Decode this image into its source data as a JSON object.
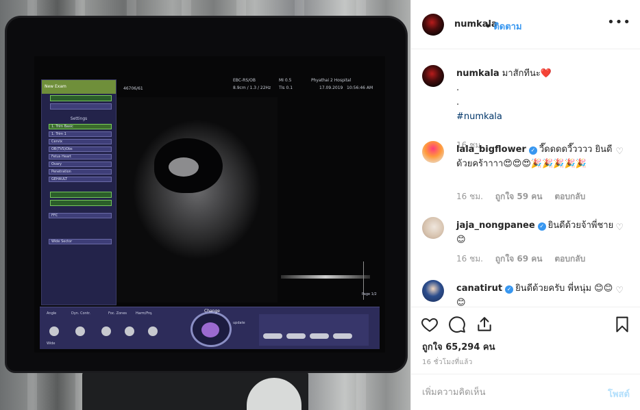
{
  "post": {
    "author": "numkala",
    "separator": "•",
    "follow_label": "ติดตาม",
    "more_label": "•••",
    "caption": {
      "text": "มาสักทีนะ",
      "heart": "❤️",
      "dot1": ".",
      "dot2": ".",
      "hashtag": "#numkala",
      "time": "16 ชม."
    }
  },
  "comments": [
    {
      "username": "lala_bigflower",
      "verified": true,
      "text": "วี๊ดดดดวี๊วววว ยินดีด้วยคร้าาาา😍😍😍🎉🎉🎉🎉🎉",
      "time": "16 ชม.",
      "likes": "ถูกใจ 59 คน",
      "reply": "ตอบกลับ"
    },
    {
      "username": "jaja_nongpanee",
      "verified": true,
      "text": "ยินดีด้วยจ้าพี่ชาย 😊",
      "time": "16 ชม.",
      "likes": "ถูกใจ 69 คน",
      "reply": "ตอบกลับ"
    },
    {
      "username": "canatirut",
      "verified": true,
      "text": "ยินดีด้วยครับ พี่หนุ่ม 😊😊😊"
    }
  ],
  "actions": {
    "like_count": "ถูกใจ 65,294 คน",
    "timestamp": "16 ชั่วโมงที่แล้ว"
  },
  "add_comment": {
    "placeholder": "เพิ่มความคิดเห็น",
    "post_label": "โพสต์"
  },
  "ultrasound": {
    "menu_header": "New Exam",
    "probe": "EBC-RS/OB",
    "mi": "MI 0.5",
    "tis": "TIs 0.1",
    "hospital": "Phyathai 2 Hospital",
    "date": "17.09.2019",
    "clock": "10:56:46 AM",
    "depth": "8.9cm / 1.3 / 22Hz",
    "patient_id": "46706/61",
    "settings_title": "Settings",
    "settings_items": [
      "1. Trim Basic",
      "1. Trim 1",
      "Cervix",
      "OB(TVS)Obs",
      "Fetus Heart",
      "Ovary",
      "Penetration",
      "GEHAULT"
    ],
    "ffc": "FFC",
    "wide_sector": "Wide Sector",
    "controls": [
      "Angle",
      "Dyn. Contr.",
      "Foc. Zones",
      "Harm/Frq."
    ],
    "change": "Change",
    "update": "update",
    "page": "Page 1/2",
    "wide": "Wide"
  }
}
